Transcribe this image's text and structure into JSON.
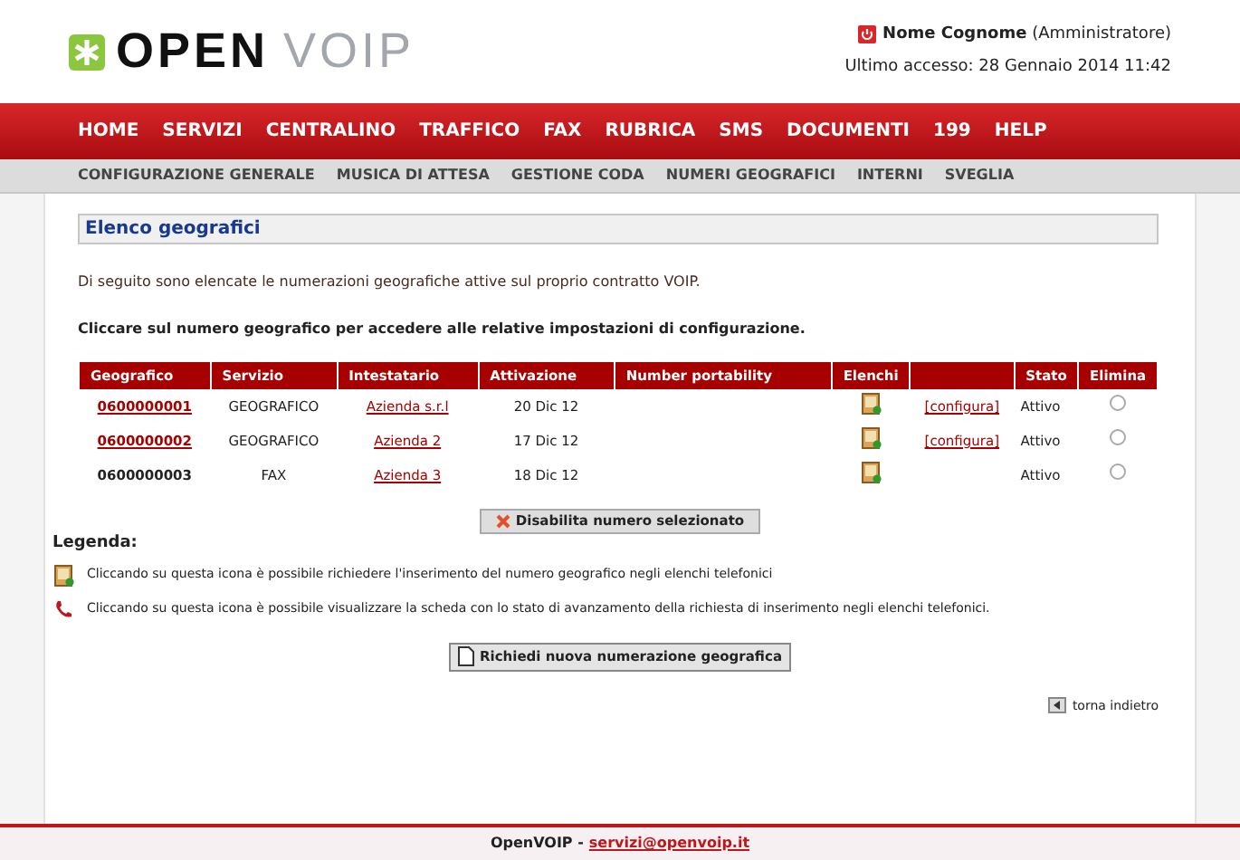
{
  "logo": {
    "first": "OPEN",
    "second": "VOIP"
  },
  "user": {
    "name": "Nome Cognome",
    "role": "(Amministratore)",
    "last_access": "Ultimo accesso: 28 Gennaio 2014 11:42"
  },
  "main_menu": [
    {
      "label": "HOME"
    },
    {
      "label": "SERVIZI"
    },
    {
      "label": "CENTRALINO"
    },
    {
      "label": "TRAFFICO"
    },
    {
      "label": "FAX"
    },
    {
      "label": "RUBRICA"
    },
    {
      "label": "SMS"
    },
    {
      "label": "DOCUMENTI"
    },
    {
      "label": "199"
    },
    {
      "label": "HELP"
    }
  ],
  "sub_menu": [
    {
      "label": "CONFIGURAZIONE GENERALE"
    },
    {
      "label": "MUSICA DI ATTESA"
    },
    {
      "label": "GESTIONE CODA"
    },
    {
      "label": "NUMERI GEOGRAFICI"
    },
    {
      "label": "INTERNI"
    },
    {
      "label": "SVEGLIA"
    }
  ],
  "section_title": "Elenco geografici",
  "intro": "Di seguito sono elencate le numerazioni geografiche attive sul proprio contratto VOIP.",
  "instruction": "Cliccare sul numero geografico per accedere alle relative impostazioni di configurazione.",
  "table": {
    "columns": [
      "Geografico",
      "Servizio",
      "Intestatario",
      "Attivazione",
      "Number portability",
      "Elenchi",
      "",
      "Stato",
      "Elimina"
    ],
    "rows": [
      {
        "number": "0600000001",
        "number_link": true,
        "service": "GEOGRAFICO",
        "holder": "Azienda s.r.l",
        "activation": "20 Dic 12",
        "configure": "[configura]",
        "status": "Attivo",
        "selected": false
      },
      {
        "number": "0600000002",
        "number_link": true,
        "service": "GEOGRAFICO",
        "holder": "Azienda 2",
        "activation": "17 Dic 12",
        "configure": "[configura]",
        "status": "Attivo",
        "selected": false
      },
      {
        "number": "0600000003",
        "number_link": false,
        "service": "FAX",
        "holder": "Azienda 3",
        "activation": "18 Dic 12",
        "status": "Attivo",
        "selected": false
      }
    ]
  },
  "disable_button": "Disabilita numero selezionato",
  "legend": {
    "title": "Legenda:",
    "items": [
      {
        "kind": "directory",
        "text": "Cliccando su questa icona è possibile richiedere l'inserimento del numero geografico negli elenchi telefonici"
      },
      {
        "kind": "phone",
        "text": "Cliccando su questa icona è possibile visualizzare la scheda con lo stato di avanzamento della richiesta di inserimento negli elenchi telefonici."
      }
    ]
  },
  "request_button": "Richiedi nuova numerazione geografica",
  "back_link": "torna indietro",
  "footer": {
    "brand": "OpenVOIP -",
    "email": "servizi@openvoip.it"
  }
}
